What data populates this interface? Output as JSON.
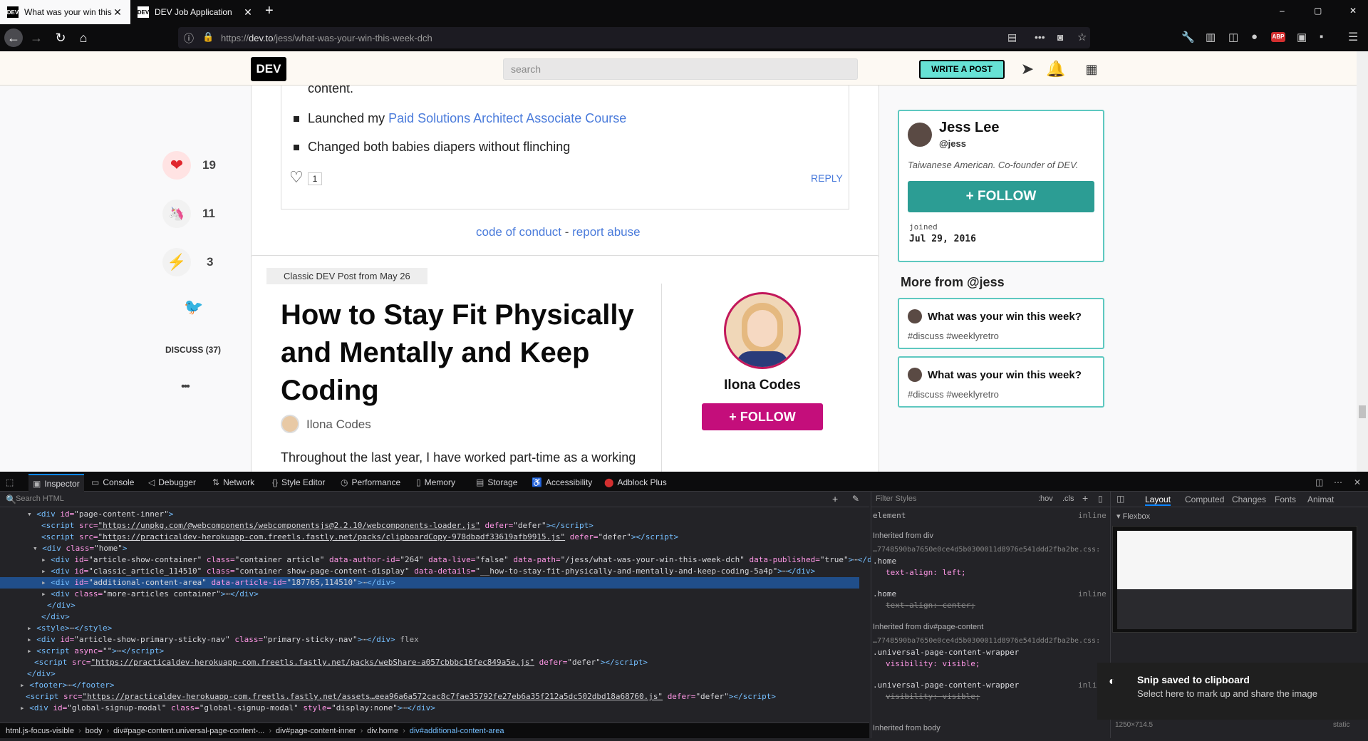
{
  "browser": {
    "tabs": [
      {
        "favicon": "DEV",
        "title": "What was your win this week?",
        "active": true
      },
      {
        "favicon": "DEV",
        "title": "DEV Job Application",
        "active": false
      }
    ],
    "new_tab": "+",
    "url_prefix": "https://",
    "url_host": "dev.to",
    "url_path": "/jess/what-was-your-win-this-week-dch",
    "page_menu": "•••",
    "min": "–",
    "max": "▢",
    "close": "✕"
  },
  "dev_header": {
    "logo": "DEV",
    "search_placeholder": "search",
    "write_post": "WRITE A POST"
  },
  "comment": {
    "line_content": "content.",
    "bullet_1_prefix": "Launched my ",
    "bullet_1_link": "Paid Solutions Architect Associate Course",
    "bullet_2": "Changed both babies diapers without flinching",
    "likes": "1",
    "reply": "REPLY"
  },
  "footer_links": {
    "conduct": "code of conduct",
    "sep": " - ",
    "abuse": "report abuse"
  },
  "reactions": {
    "hearts": "19",
    "unicorns": "11",
    "bookmarks": "3",
    "discuss": "DISCUSS (37)",
    "more": "•••"
  },
  "classic_post": {
    "badge": "Classic DEV Post from May 26",
    "title": "How to Stay Fit Physically and Mentally and Keep Coding",
    "author": "Ilona Codes",
    "excerpt": "Throughout the last year, I have worked part-time as a working",
    "side_name": "Ilona Codes",
    "side_follow": "+ FOLLOW"
  },
  "profile": {
    "name": "Jess Lee",
    "handle": "@jess",
    "bio": "Taiwanese American. Co-founder of DEV.",
    "follow": "+ FOLLOW",
    "joined_label": "joined",
    "joined_date": "Jul 29, 2016"
  },
  "more_from": {
    "heading": "More from @jess",
    "items": [
      {
        "title": "What was your win this week?",
        "tags": "#discuss #weeklyretro"
      },
      {
        "title": "What was your win this week?",
        "tags": "#discuss #weeklyretro"
      }
    ]
  },
  "devtools": {
    "tabs": [
      "Inspector",
      "Console",
      "Debugger",
      "Network",
      "Style Editor",
      "Performance",
      "Memory",
      "Storage",
      "Accessibility",
      "Adblock Plus"
    ],
    "search_html": "Search HTML",
    "filter_styles": "Filter Styles",
    "hov": ":hov",
    "cls": ".cls",
    "side_tabs": [
      "Layout",
      "Computed",
      "Changes",
      "Fonts",
      "Animat"
    ],
    "flexbox": "Flexbox",
    "breadcrumbs": [
      "html.js-focus-visible",
      "body",
      "div#page-content.universal-page-content-...",
      "div#page-content-inner",
      "div.home",
      "div#additional-content-area"
    ],
    "rules": {
      "element": "element",
      "inline": "inline",
      "inherited_div": "Inherited from div",
      "css_file": "…7748590ba7650e0ce4d5b0300011d8976e541ddd2fba2be.css:",
      "home_sel": ".home",
      "text_align_left": "text-align: left;",
      "text_align_center": "text-align: center;",
      "inherited_page_content": "Inherited from div#page-content",
      "upcw": ".universal-page-content-wrapper",
      "visibility_visible": "visibility: visible;",
      "inherited_body": "Inherited from body"
    },
    "size_label": "1250×714.5",
    "static": "static",
    "snip_title": "Snip saved to clipboard",
    "snip_body": "Select here to mark up and share the image"
  }
}
